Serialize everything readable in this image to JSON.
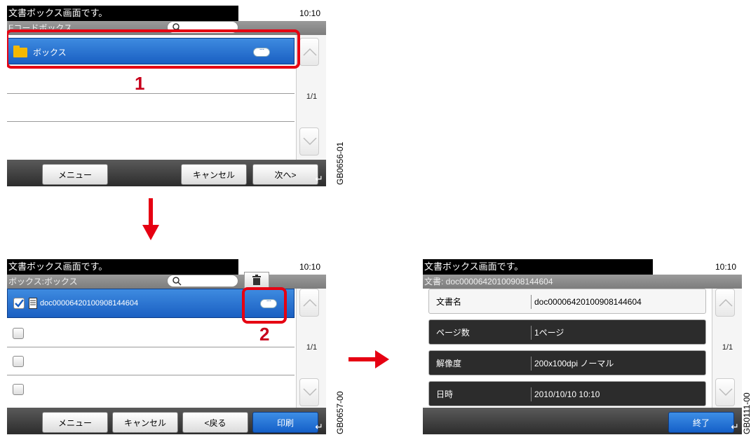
{
  "screen1": {
    "status_message": "文書ボックス画面です。",
    "time": "10:10",
    "subtitle": "Fコードボックス",
    "rows": [
      {
        "label": "ボックス"
      }
    ],
    "page": "1/1",
    "buttons": {
      "menu": "メニュー",
      "cancel": "キャンセル",
      "next": "次へ>"
    },
    "code": "GB0656-01",
    "callout": "1"
  },
  "screen2": {
    "status_message": "文書ボックス画面です。",
    "time": "10:10",
    "subtitle": "ボックス:ボックス",
    "rows": [
      {
        "label": "doc00006420100908144604",
        "checked": true
      }
    ],
    "page": "1/1",
    "buttons": {
      "menu": "メニュー",
      "cancel": "キャンセル",
      "back": "<戻る",
      "print": "印刷"
    },
    "code": "GB0657-00",
    "callout": "2"
  },
  "screen3": {
    "status_message": "文書ボックス画面です。",
    "time": "10:10",
    "subtitle": "文書: doc00006420100908144604",
    "details": [
      {
        "key": "文書名",
        "value": "doc00006420100908144604"
      },
      {
        "key": "ページ数",
        "value": "1ページ"
      },
      {
        "key": "解像度",
        "value": "200x100dpi ノーマル"
      },
      {
        "key": "日時",
        "value": "2010/10/10 10:10"
      }
    ],
    "page": "1/1",
    "buttons": {
      "end": "終了"
    },
    "code": "GB0111-00"
  },
  "colors": {
    "accent_blue": "#1a5fc2",
    "callout_red": "#e60012"
  },
  "icons": [
    "folder-icon",
    "search-icon",
    "trash-icon",
    "document-icon",
    "detail-pill-icon",
    "chevron-up-icon",
    "chevron-down-icon",
    "enter-icon",
    "arrow-down",
    "arrow-right"
  ]
}
